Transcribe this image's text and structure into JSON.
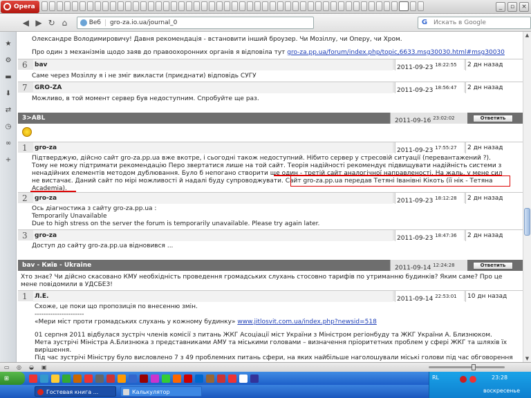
{
  "browser": {
    "app_name": "Opera",
    "address": {
      "web_label": "Веб",
      "url": "gro-za.io.ua/journal_0"
    },
    "search": {
      "placeholder": "Искать в Google"
    }
  },
  "content": {
    "top_lines": [
      "Олександре Володимировичу! Давня рекомендація - встановити інший броузер. Чи Мозіллу, чи Оперу, чи Хром.",
      "Про один з механізмів щодо заяв до правоохоронних органів я відповіла тут "
    ],
    "top_link": "gro-za.pp.ua/forum/index.php/topic,6633.msg30030.html#msg30030",
    "comments_a": [
      {
        "num": "6",
        "name": "bav",
        "date": "2011-09-23",
        "time": "18:22:55",
        "ago": "2 дн назад",
        "body": "Саме через Мозіллу я і не зміг викласти (приєднати) відповідь СУГУ"
      },
      {
        "num": "7",
        "name": "GRO-ZA",
        "date": "2011-09-23",
        "time": "18:56:47",
        "ago": "2 дн назад",
        "body": "Можливо, в той момент сервер був недоступним. Спробуйте ще раз."
      }
    ],
    "post1": {
      "title": "3>ABL",
      "date": "2011-09-16",
      "time": "23:02:02",
      "reply_label": "Ответить"
    },
    "comments_b": [
      {
        "num": "1",
        "name": "gro-za",
        "date": "2011-09-23",
        "time": "17:55:27",
        "ago": "2 дн назад",
        "lines": [
          "Підтверджую, дійсно сайт gro-za.pp.ua вже вкотре, і сьогодні також недоступний. Нібито сервер у стресовій ситуації (перевантажений ?).",
          "Тому не можу підтримати рекомендацію Перо звертатися лише на той сайт. Теорія надійності рекомендує підвищувати надійність системи з",
          "ненадійних елементів методом дублювання. Було б непогано створити ще один - третій сайт аналогічної направленості. На жаль, у мене сил",
          "не вистачає. Даний сайт по мірі можливості й надалі буду супроводжувати. Сайт gro-za.pp.ua передав Тетяні Іванівні Кікоть (її нік - Тетяна",
          "Academia)."
        ]
      },
      {
        "num": "2",
        "name": "gro-za",
        "date": "2011-09-23",
        "time": "18:12:28",
        "ago": "2 дн назад",
        "lines": [
          "Ось діагностика з сайту gro-za.pp.ua :",
          "Temporarily Unavailable",
          "Due to high stress on the server the forum is temporarily unavailable. Please try again later."
        ]
      },
      {
        "num": "3",
        "name": "gro-za",
        "date": "2011-09-23",
        "time": "18:47:36",
        "ago": "2 дн назад",
        "lines": [
          "Доступ до сайту gro-za.pp.ua відновився ..."
        ]
      }
    ],
    "post2": {
      "title": "bav - Київ - Ukraine",
      "date": "2011-09-14",
      "time": "12:24:28",
      "reply_label": "Ответить",
      "lines": [
        "Хто знає? Чи дійсно скасовано КМУ необхідність проведення громадських слухань стосовно тарифів по утриманню будинків? Яким саме? Про це",
        "мене повідомили в УДСБЕЗ!"
      ]
    },
    "comment_c": {
      "num": "1",
      "name": "Л.Е.",
      "date": "2011-09-14",
      "time": "22:53:01",
      "ago": "10 дн назад",
      "lines": [
        "Схоже, це поки що пропозиція по внесенню змін.",
        "----------------------",
        "«Мери міст проти громадських слухань у кожному будинку» ",
        "01 серпня 2011 відбулася зустріч членів комісії з питань ЖКГ Асоціації міст України з Міністром регіонбуду та ЖКГ України А. Близнюком.",
        "Мета зустрічі Міністра А.Близнюка з представниками АМУ та міськими головами – визначення пріоритетних проблем у сфері ЖКГ та шляхів їх",
        "вирішення.",
        "Під час зустрічі Міністру було висловлено 7 з 49 проблемних питань сфери, на яких найбільше наголошували міські голови під час обговорення"
      ],
      "link": "www.jitlosvit.com.ua/index.php?newsid=518"
    }
  },
  "taskbar": {
    "tasks": [
      "Гостевая книга ...",
      "Калькулятор"
    ],
    "tray": {
      "lang": "RL",
      "time": "23:28",
      "day": "воскресенье"
    }
  }
}
